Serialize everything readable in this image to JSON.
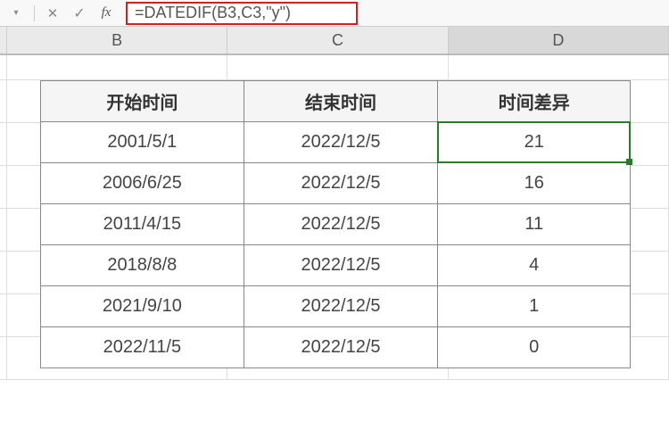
{
  "formula_bar": {
    "formula": "=DATEDIF(B3,C3,\"y\")",
    "fx_label": "fx"
  },
  "columns": {
    "b": "B",
    "c": "C",
    "d": "D"
  },
  "table": {
    "headers": {
      "start": "开始时间",
      "end": "结束时间",
      "diff": "时间差异"
    },
    "rows": [
      {
        "start": "2001/5/1",
        "end": "2022/12/5",
        "diff": "21"
      },
      {
        "start": "2006/6/25",
        "end": "2022/12/5",
        "diff": "16"
      },
      {
        "start": "2011/4/15",
        "end": "2022/12/5",
        "diff": "11"
      },
      {
        "start": "2018/8/8",
        "end": "2022/12/5",
        "diff": "4"
      },
      {
        "start": "2021/9/10",
        "end": "2022/12/5",
        "diff": "1"
      },
      {
        "start": "2022/11/5",
        "end": "2022/12/5",
        "diff": "0"
      }
    ]
  },
  "active_cell": "D3"
}
